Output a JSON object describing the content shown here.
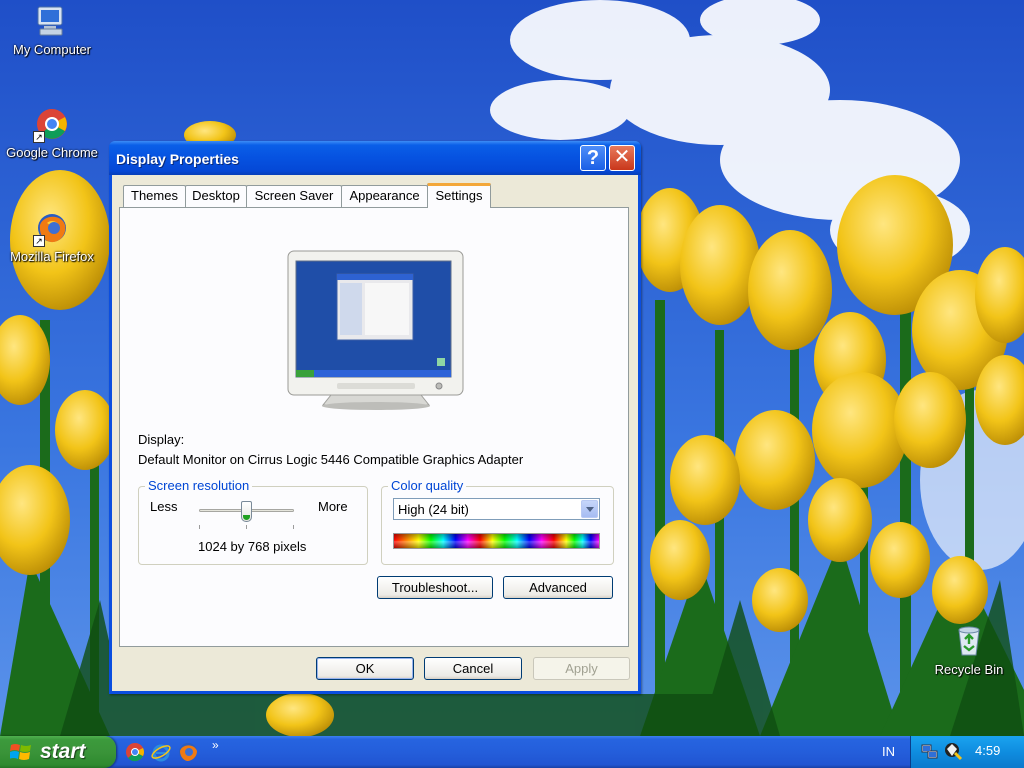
{
  "desktop": {
    "icons": [
      {
        "label": "My Computer",
        "icon": "my-computer-icon"
      },
      {
        "label": "Google Chrome",
        "icon": "chrome-icon"
      },
      {
        "label": "Mozilla Firefox",
        "icon": "firefox-icon"
      },
      {
        "label": "Recycle Bin",
        "icon": "recycle-bin-icon"
      }
    ]
  },
  "window": {
    "title": "Display Properties",
    "help_button": "?",
    "close_button": "✕",
    "tabs": [
      {
        "label": "Themes"
      },
      {
        "label": "Desktop"
      },
      {
        "label": "Screen Saver"
      },
      {
        "label": "Appearance"
      },
      {
        "label": "Settings",
        "active": true
      }
    ],
    "settings": {
      "display_label": "Display:",
      "display_value": "Default Monitor on Cirrus Logic 5446 Compatible Graphics Adapter",
      "screen_resolution": {
        "group_title": "Screen resolution",
        "less_label": "Less",
        "more_label": "More",
        "value_text": "1024 by 768 pixels",
        "slider_fraction": 0.5
      },
      "color_quality": {
        "group_title": "Color quality",
        "selected": "High (24 bit)"
      },
      "troubleshoot_button": "Troubleshoot...",
      "advanced_button": "Advanced"
    },
    "footer": {
      "ok_button": "OK",
      "cancel_button": "Cancel",
      "apply_button": "Apply"
    }
  },
  "taskbar": {
    "start_label": "start",
    "quick_launch": [
      "chrome-icon",
      "internet-explorer-icon",
      "firefox-icon"
    ],
    "overflow": "»",
    "language": "IN",
    "clock": "4:59"
  },
  "colors": {
    "title_blue": "#0a4ee0",
    "start_green": "#3a9439",
    "tray_blue": "#0f8de0",
    "group_title": "#0046d5",
    "active_tab_accent": "#f3a73a"
  }
}
